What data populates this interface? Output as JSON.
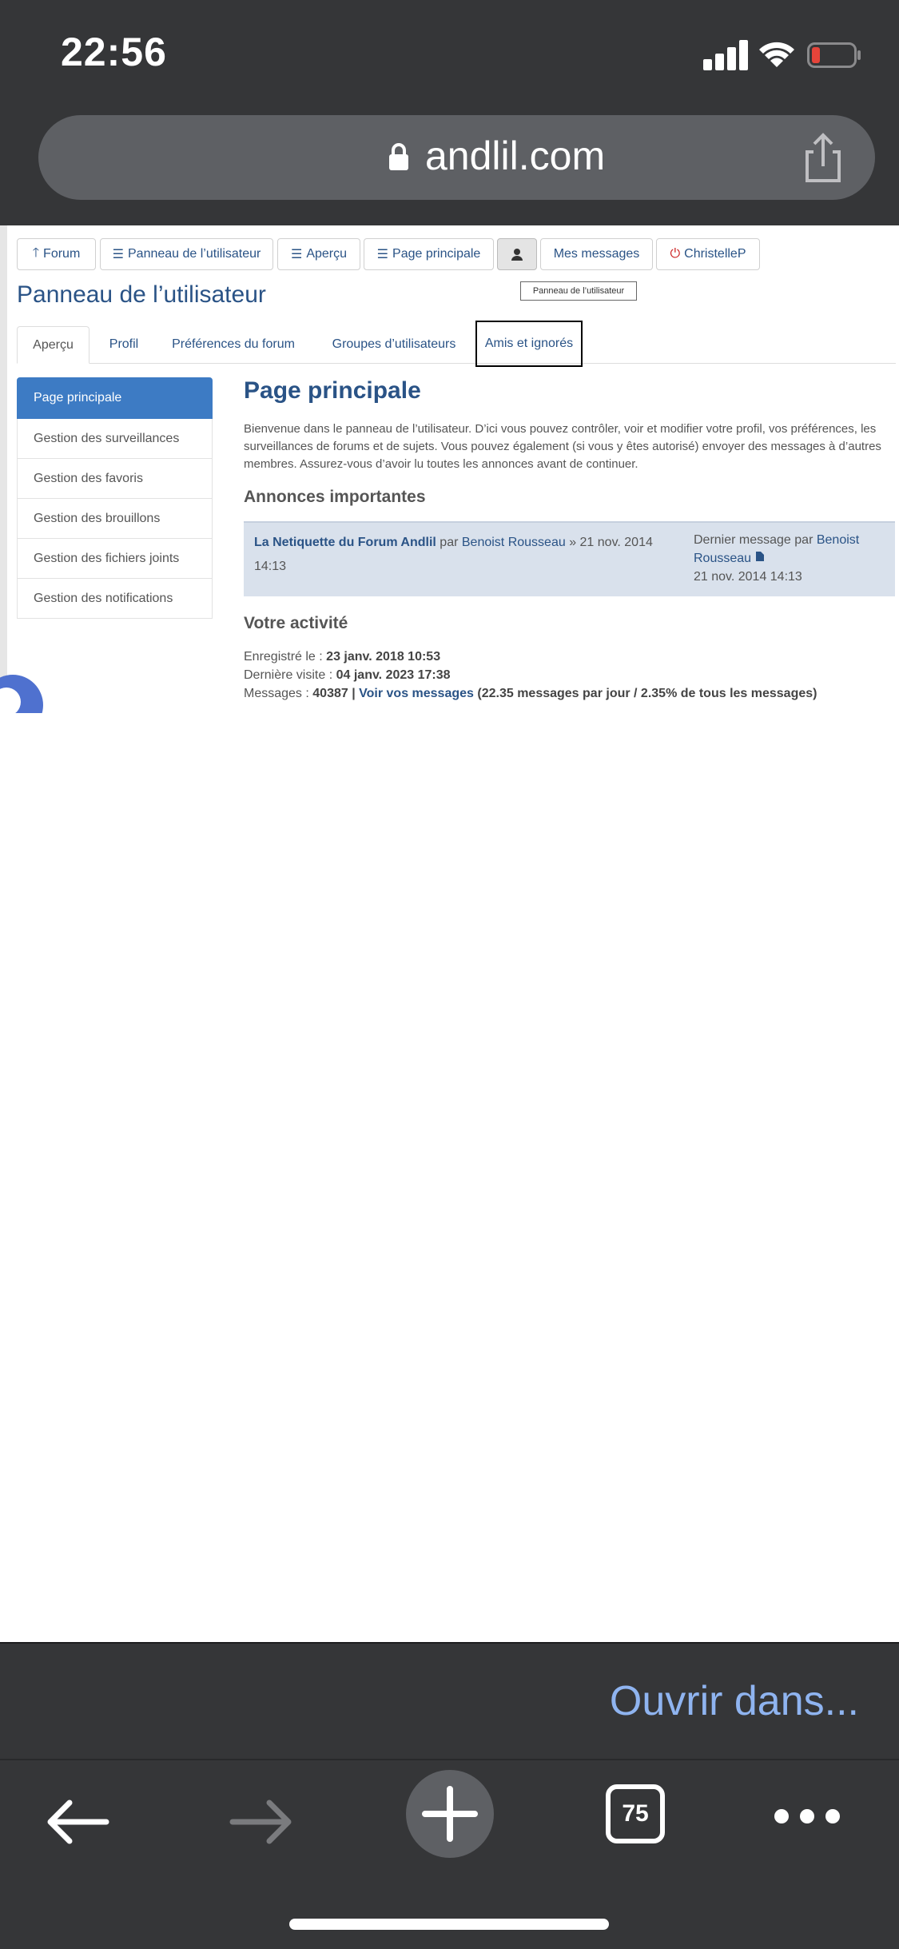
{
  "status_bar": {
    "time": "22:56"
  },
  "browser": {
    "url": "andlil.com",
    "open_in_label": "Ouvrir dans...",
    "tab_count": "75"
  },
  "topnav": {
    "forum": "Forum",
    "panel": "Panneau de l’utilisateur",
    "apercu": "Aperçu",
    "page_principale": "Page principale",
    "mes_messages": "Mes messages",
    "user": "ChristelleP",
    "tooltip": "Panneau de l’utilisateur"
  },
  "panel_title": "Panneau de l’utilisateur",
  "tabs": [
    "Aperçu",
    "Profil",
    "Préférences du forum",
    "Groupes d’utilisateurs",
    "Amis et ignorés"
  ],
  "sidemenu": [
    "Page principale",
    "Gestion des surveillances",
    "Gestion des favoris",
    "Gestion des brouillons",
    "Gestion des fichiers joints",
    "Gestion des notifications"
  ],
  "main": {
    "title": "Page principale",
    "intro": "Bienvenue dans le panneau de l’utilisateur. D’ici vous pouvez contrôler, voir et modifier votre profil, vos préférences, les surveillances de forums et de sujets. Vous pouvez également (si vous y êtes autorisé) envoyer des messages à d’autres membres. Assurez-vous d’avoir lu toutes les annonces avant de continuer.",
    "announcements_heading": "Annonces importantes",
    "announcement": {
      "title": "La Netiquette du Forum Andlil",
      "by": "par",
      "author": "Benoist Rousseau",
      "date": "» 21 nov. 2014 14:13",
      "last_label": "Dernier message par",
      "last_author": "Benoist Rousseau",
      "last_date": "21 nov. 2014 14:13"
    },
    "activity_heading": "Votre activité",
    "activity": {
      "registered_label": "Enregistré le :",
      "registered_value": "23 janv. 2018 10:53",
      "last_visit_label": "Dernière visite :",
      "last_visit_value": "04 janv. 2023 17:38",
      "messages_label": "Messages :",
      "messages_count": "40387 |",
      "messages_link": "Voir vos messages",
      "messages_stats": "(22.35 messages par jour / 2.35% de tous les messages)"
    }
  },
  "colors": {
    "link": "#2a5386",
    "active_menu": "#3d7bc4",
    "chrome": "#353638",
    "open_in": "#8fb4f0"
  }
}
